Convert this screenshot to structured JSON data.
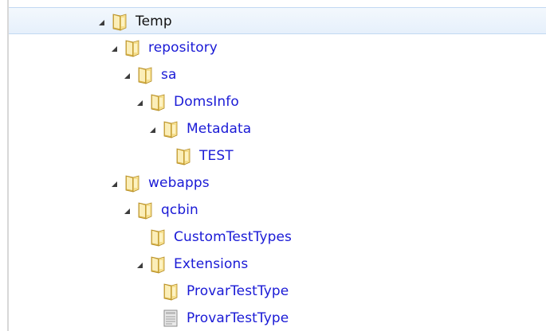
{
  "tree": {
    "nodes": [
      {
        "id": "temp",
        "label": "Temp",
        "depth": 0,
        "expanded": true,
        "has_children": true,
        "icon": "folder-icon",
        "selected": true
      },
      {
        "id": "repository",
        "label": "repository",
        "depth": 1,
        "expanded": true,
        "has_children": true,
        "icon": "folder-icon",
        "selected": false
      },
      {
        "id": "sa",
        "label": "sa",
        "depth": 2,
        "expanded": true,
        "has_children": true,
        "icon": "folder-icon",
        "selected": false
      },
      {
        "id": "domsinfo",
        "label": "DomsInfo",
        "depth": 3,
        "expanded": true,
        "has_children": true,
        "icon": "folder-icon",
        "selected": false
      },
      {
        "id": "metadata",
        "label": "Metadata",
        "depth": 4,
        "expanded": true,
        "has_children": true,
        "icon": "folder-icon",
        "selected": false
      },
      {
        "id": "test",
        "label": "TEST",
        "depth": 5,
        "expanded": false,
        "has_children": false,
        "icon": "folder-icon",
        "selected": false
      },
      {
        "id": "webapps",
        "label": "webapps",
        "depth": 1,
        "expanded": true,
        "has_children": true,
        "icon": "folder-icon",
        "selected": false
      },
      {
        "id": "qcbin",
        "label": "qcbin",
        "depth": 2,
        "expanded": true,
        "has_children": true,
        "icon": "folder-icon",
        "selected": false
      },
      {
        "id": "customtesttypes",
        "label": "CustomTestTypes",
        "depth": 3,
        "expanded": false,
        "has_children": false,
        "icon": "folder-icon",
        "selected": false
      },
      {
        "id": "extensions",
        "label": "Extensions",
        "depth": 3,
        "expanded": true,
        "has_children": true,
        "icon": "folder-icon",
        "selected": false
      },
      {
        "id": "provartesttype-folder",
        "label": "ProvarTestType",
        "depth": 4,
        "expanded": false,
        "has_children": false,
        "icon": "folder-icon",
        "selected": false
      },
      {
        "id": "provartesttype-file",
        "label": "ProvarTestType",
        "depth": 4,
        "expanded": false,
        "has_children": false,
        "icon": "file-icon",
        "selected": false
      }
    ]
  },
  "colors": {
    "label": "#1a1ad6",
    "selected_label": "#111111",
    "folder_light": "#f6df8e",
    "folder_dark": "#d9b44a",
    "folder_outline": "#b38b22"
  }
}
